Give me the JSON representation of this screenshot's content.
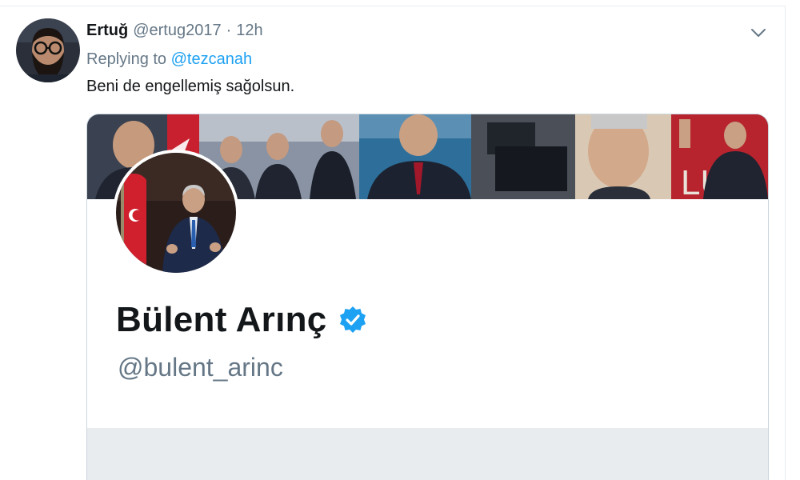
{
  "tweet": {
    "author_name": "Ertuğ",
    "author_handle": "@ertug2017",
    "separator": "·",
    "timestamp": "12h",
    "reply_prefix": "Replying to",
    "reply_mention": "@tezcanah",
    "text": "Beni de engellemiş sağolsun."
  },
  "card": {
    "profile_name": "Bülent Arınç",
    "profile_handle": "@bulent_arinc",
    "verified": true
  },
  "icons": {
    "caret": "chevron-down-icon",
    "verified": "verified-badge-icon"
  },
  "colors": {
    "link": "#1da1f2",
    "secondary_text": "#657786",
    "primary_text": "#14171a",
    "verified": "#1da1f2",
    "card_bottom": "#e8ecef"
  }
}
